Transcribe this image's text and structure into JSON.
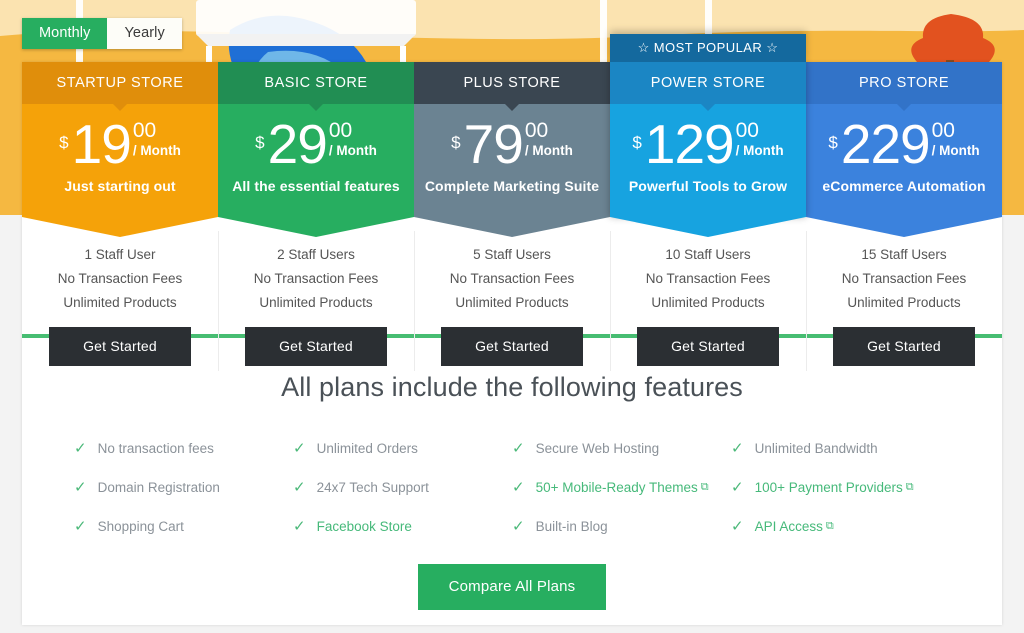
{
  "billing_toggle": {
    "options": [
      {
        "label": "Monthly",
        "active": true
      },
      {
        "label": "Yearly",
        "active": false
      }
    ]
  },
  "plans": [
    {
      "name": "STARTUP STORE",
      "ribbon": null,
      "currency": "$",
      "amount": "19",
      "cents": "00",
      "period": "/ Month",
      "tagline": "Just starting out",
      "features": [
        "1 Staff User",
        "No Transaction Fees",
        "Unlimited Products"
      ],
      "cta_label": "Get Started",
      "header_color": "#e08e0b",
      "body_color": "#f5a209"
    },
    {
      "name": "BASIC STORE",
      "ribbon": null,
      "currency": "$",
      "amount": "29",
      "cents": "00",
      "period": "/ Month",
      "tagline": "All the essential features",
      "features": [
        "2 Staff Users",
        "No Transaction Fees",
        "Unlimited Products"
      ],
      "cta_label": "Get Started",
      "header_color": "#218e53",
      "body_color": "#27ae60"
    },
    {
      "name": "PLUS STORE",
      "ribbon": null,
      "currency": "$",
      "amount": "79",
      "cents": "00",
      "period": "/ Month",
      "tagline": "Complete Marketing Suite",
      "features": [
        "5 Staff Users",
        "No Transaction Fees",
        "Unlimited Products"
      ],
      "cta_label": "Get Started",
      "header_color": "#3a4651",
      "body_color": "#6b8392"
    },
    {
      "name": "POWER STORE",
      "ribbon": "☆ MOST POPULAR ☆",
      "currency": "$",
      "amount": "129",
      "cents": "00",
      "period": "/ Month",
      "tagline": "Powerful Tools to Grow",
      "features": [
        "10 Staff Users",
        "No Transaction Fees",
        "Unlimited Products"
      ],
      "cta_label": "Get Started",
      "header_color": "#1b86c4",
      "body_color": "#17a3e0"
    },
    {
      "name": "PRO STORE",
      "ribbon": null,
      "currency": "$",
      "amount": "229",
      "cents": "00",
      "period": "/ Month",
      "tagline": "eCommerce Automation",
      "features": [
        "15 Staff Users",
        "No Transaction Fees",
        "Unlimited Products"
      ],
      "cta_label": "Get Started",
      "header_color": "#3273c8",
      "body_color": "#3b82dd"
    }
  ],
  "features_section": {
    "heading": "All plans include the following features",
    "items": [
      {
        "label": "No transaction fees",
        "link": false,
        "external": false
      },
      {
        "label": "Domain Registration",
        "link": false,
        "external": false
      },
      {
        "label": "Shopping Cart",
        "link": false,
        "external": false
      },
      {
        "label": "Unlimited Orders",
        "link": false,
        "external": false
      },
      {
        "label": "24x7 Tech Support",
        "link": false,
        "external": false
      },
      {
        "label": "Facebook Store",
        "link": true,
        "external": false
      },
      {
        "label": "Secure Web Hosting",
        "link": false,
        "external": false
      },
      {
        "label": "50+ Mobile-Ready Themes",
        "link": true,
        "external": true
      },
      {
        "label": "Built-in Blog",
        "link": false,
        "external": false
      },
      {
        "label": "Unlimited Bandwidth",
        "link": false,
        "external": false
      },
      {
        "label": "100+ Payment Providers",
        "link": true,
        "external": true
      },
      {
        "label": "API Access",
        "link": true,
        "external": true
      }
    ],
    "check_glyph": "✓",
    "external_glyph": "⧉",
    "compare_label": "Compare All Plans"
  },
  "colors": {
    "accent_green": "#27ae60",
    "divider_green": "#47bd72",
    "page_bg": "#f3f3f3",
    "bg_amber": "#f5b841",
    "cta_dark": "#2b2f33"
  }
}
